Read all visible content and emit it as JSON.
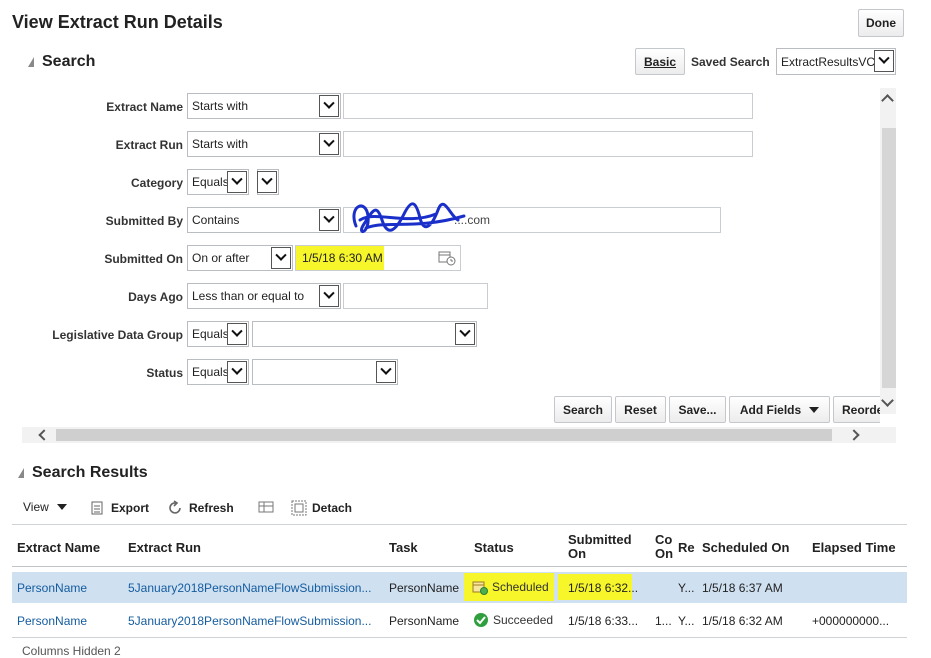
{
  "page": {
    "title": "View Extract Run Details",
    "done_label": "Done"
  },
  "search": {
    "header": "Search",
    "basic_label": "Basic",
    "saved_search_label": "Saved Search",
    "saved_search_value": "ExtractResultsVC",
    "fields": {
      "extract_name": {
        "label": "Extract Name",
        "operator": "Starts with",
        "value": ""
      },
      "extract_run": {
        "label": "Extract Run",
        "operator": "Starts with",
        "value": ""
      },
      "category": {
        "label": "Category",
        "operator": "Equals",
        "value": ""
      },
      "submitted_by": {
        "label": "Submitted By",
        "operator": "Contains",
        "value": "....com"
      },
      "submitted_on": {
        "label": "Submitted On",
        "operator": "On or after",
        "value": "1/5/18 6:30 AM"
      },
      "days_ago": {
        "label": "Days Ago",
        "operator": "Less than or equal to",
        "value": ""
      },
      "ldg": {
        "label": "Legislative Data Group",
        "operator": "Equals",
        "value": ""
      },
      "status": {
        "label": "Status",
        "operator": "Equals",
        "value": ""
      }
    },
    "buttons": {
      "search": "Search",
      "reset": "Reset",
      "save": "Save...",
      "add_fields": "Add Fields",
      "reorder": "Reorder"
    }
  },
  "results": {
    "header": "Search Results",
    "toolbar": {
      "view": "View",
      "export": "Export",
      "refresh": "Refresh",
      "detach": "Detach"
    },
    "columns": {
      "extract_name": "Extract Name",
      "extract_run": "Extract Run",
      "task": "Task",
      "status": "Status",
      "submitted_on_1": "Submitted",
      "submitted_on_2": "On",
      "co_1": "Co",
      "co_2": "On",
      "re": "Re",
      "scheduled_on": "Scheduled On",
      "elapsed_time": "Elapsed Time"
    },
    "rows": [
      {
        "extract_name": "PersonName",
        "extract_run": "5January2018PersonNameFlowSubmission...",
        "task": "PersonName",
        "status": "Scheduled",
        "submitted_on": "1/5/18 6:32...",
        "co": "",
        "re": "Y...",
        "scheduled_on": "1/5/18 6:37 AM",
        "elapsed_time": ""
      },
      {
        "extract_name": "PersonName",
        "extract_run": "5January2018PersonNameFlowSubmission...",
        "task": "PersonName",
        "status": "Succeeded",
        "submitted_on": "1/5/18 6:33...",
        "co": "1...",
        "re": "Y...",
        "scheduled_on": "1/5/18 6:32 AM",
        "elapsed_time": "+000000000..."
      }
    ],
    "footer": "Columns Hidden  2"
  },
  "colors": {
    "highlight": "#f6f62a",
    "selected_row": "#cfe0f1",
    "link": "#145c9e",
    "success": "#2e9e3e"
  }
}
